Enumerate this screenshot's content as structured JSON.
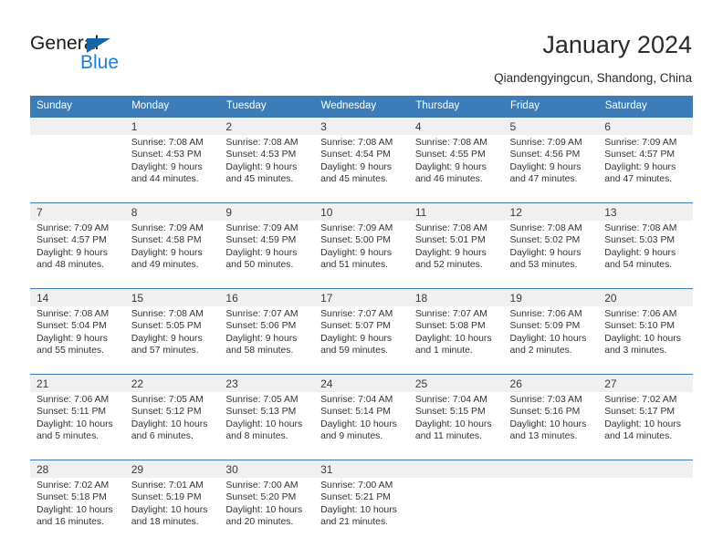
{
  "logo": {
    "word_top": "General",
    "word_bottom": "Blue",
    "triangle_color": "#1464aa",
    "blue_color": "#1f7fd4"
  },
  "header": {
    "title": "January 2024",
    "location": "Qiandengyingcun, Shandong, China",
    "header_bg": "#3b7cb9",
    "daynum_bg": "#f0f0f0"
  },
  "weekdays": [
    "Sunday",
    "Monday",
    "Tuesday",
    "Wednesday",
    "Thursday",
    "Friday",
    "Saturday"
  ],
  "weeks": [
    [
      {
        "day": "",
        "sunrise": "",
        "sunset": "",
        "daylight1": "",
        "daylight2": ""
      },
      {
        "day": "1",
        "sunrise": "Sunrise: 7:08 AM",
        "sunset": "Sunset: 4:53 PM",
        "daylight1": "Daylight: 9 hours",
        "daylight2": "and 44 minutes."
      },
      {
        "day": "2",
        "sunrise": "Sunrise: 7:08 AM",
        "sunset": "Sunset: 4:53 PM",
        "daylight1": "Daylight: 9 hours",
        "daylight2": "and 45 minutes."
      },
      {
        "day": "3",
        "sunrise": "Sunrise: 7:08 AM",
        "sunset": "Sunset: 4:54 PM",
        "daylight1": "Daylight: 9 hours",
        "daylight2": "and 45 minutes."
      },
      {
        "day": "4",
        "sunrise": "Sunrise: 7:08 AM",
        "sunset": "Sunset: 4:55 PM",
        "daylight1": "Daylight: 9 hours",
        "daylight2": "and 46 minutes."
      },
      {
        "day": "5",
        "sunrise": "Sunrise: 7:09 AM",
        "sunset": "Sunset: 4:56 PM",
        "daylight1": "Daylight: 9 hours",
        "daylight2": "and 47 minutes."
      },
      {
        "day": "6",
        "sunrise": "Sunrise: 7:09 AM",
        "sunset": "Sunset: 4:57 PM",
        "daylight1": "Daylight: 9 hours",
        "daylight2": "and 47 minutes."
      }
    ],
    [
      {
        "day": "7",
        "sunrise": "Sunrise: 7:09 AM",
        "sunset": "Sunset: 4:57 PM",
        "daylight1": "Daylight: 9 hours",
        "daylight2": "and 48 minutes."
      },
      {
        "day": "8",
        "sunrise": "Sunrise: 7:09 AM",
        "sunset": "Sunset: 4:58 PM",
        "daylight1": "Daylight: 9 hours",
        "daylight2": "and 49 minutes."
      },
      {
        "day": "9",
        "sunrise": "Sunrise: 7:09 AM",
        "sunset": "Sunset: 4:59 PM",
        "daylight1": "Daylight: 9 hours",
        "daylight2": "and 50 minutes."
      },
      {
        "day": "10",
        "sunrise": "Sunrise: 7:09 AM",
        "sunset": "Sunset: 5:00 PM",
        "daylight1": "Daylight: 9 hours",
        "daylight2": "and 51 minutes."
      },
      {
        "day": "11",
        "sunrise": "Sunrise: 7:08 AM",
        "sunset": "Sunset: 5:01 PM",
        "daylight1": "Daylight: 9 hours",
        "daylight2": "and 52 minutes."
      },
      {
        "day": "12",
        "sunrise": "Sunrise: 7:08 AM",
        "sunset": "Sunset: 5:02 PM",
        "daylight1": "Daylight: 9 hours",
        "daylight2": "and 53 minutes."
      },
      {
        "day": "13",
        "sunrise": "Sunrise: 7:08 AM",
        "sunset": "Sunset: 5:03 PM",
        "daylight1": "Daylight: 9 hours",
        "daylight2": "and 54 minutes."
      }
    ],
    [
      {
        "day": "14",
        "sunrise": "Sunrise: 7:08 AM",
        "sunset": "Sunset: 5:04 PM",
        "daylight1": "Daylight: 9 hours",
        "daylight2": "and 55 minutes."
      },
      {
        "day": "15",
        "sunrise": "Sunrise: 7:08 AM",
        "sunset": "Sunset: 5:05 PM",
        "daylight1": "Daylight: 9 hours",
        "daylight2": "and 57 minutes."
      },
      {
        "day": "16",
        "sunrise": "Sunrise: 7:07 AM",
        "sunset": "Sunset: 5:06 PM",
        "daylight1": "Daylight: 9 hours",
        "daylight2": "and 58 minutes."
      },
      {
        "day": "17",
        "sunrise": "Sunrise: 7:07 AM",
        "sunset": "Sunset: 5:07 PM",
        "daylight1": "Daylight: 9 hours",
        "daylight2": "and 59 minutes."
      },
      {
        "day": "18",
        "sunrise": "Sunrise: 7:07 AM",
        "sunset": "Sunset: 5:08 PM",
        "daylight1": "Daylight: 10 hours",
        "daylight2": "and 1 minute."
      },
      {
        "day": "19",
        "sunrise": "Sunrise: 7:06 AM",
        "sunset": "Sunset: 5:09 PM",
        "daylight1": "Daylight: 10 hours",
        "daylight2": "and 2 minutes."
      },
      {
        "day": "20",
        "sunrise": "Sunrise: 7:06 AM",
        "sunset": "Sunset: 5:10 PM",
        "daylight1": "Daylight: 10 hours",
        "daylight2": "and 3 minutes."
      }
    ],
    [
      {
        "day": "21",
        "sunrise": "Sunrise: 7:06 AM",
        "sunset": "Sunset: 5:11 PM",
        "daylight1": "Daylight: 10 hours",
        "daylight2": "and 5 minutes."
      },
      {
        "day": "22",
        "sunrise": "Sunrise: 7:05 AM",
        "sunset": "Sunset: 5:12 PM",
        "daylight1": "Daylight: 10 hours",
        "daylight2": "and 6 minutes."
      },
      {
        "day": "23",
        "sunrise": "Sunrise: 7:05 AM",
        "sunset": "Sunset: 5:13 PM",
        "daylight1": "Daylight: 10 hours",
        "daylight2": "and 8 minutes."
      },
      {
        "day": "24",
        "sunrise": "Sunrise: 7:04 AM",
        "sunset": "Sunset: 5:14 PM",
        "daylight1": "Daylight: 10 hours",
        "daylight2": "and 9 minutes."
      },
      {
        "day": "25",
        "sunrise": "Sunrise: 7:04 AM",
        "sunset": "Sunset: 5:15 PM",
        "daylight1": "Daylight: 10 hours",
        "daylight2": "and 11 minutes."
      },
      {
        "day": "26",
        "sunrise": "Sunrise: 7:03 AM",
        "sunset": "Sunset: 5:16 PM",
        "daylight1": "Daylight: 10 hours",
        "daylight2": "and 13 minutes."
      },
      {
        "day": "27",
        "sunrise": "Sunrise: 7:02 AM",
        "sunset": "Sunset: 5:17 PM",
        "daylight1": "Daylight: 10 hours",
        "daylight2": "and 14 minutes."
      }
    ],
    [
      {
        "day": "28",
        "sunrise": "Sunrise: 7:02 AM",
        "sunset": "Sunset: 5:18 PM",
        "daylight1": "Daylight: 10 hours",
        "daylight2": "and 16 minutes."
      },
      {
        "day": "29",
        "sunrise": "Sunrise: 7:01 AM",
        "sunset": "Sunset: 5:19 PM",
        "daylight1": "Daylight: 10 hours",
        "daylight2": "and 18 minutes."
      },
      {
        "day": "30",
        "sunrise": "Sunrise: 7:00 AM",
        "sunset": "Sunset: 5:20 PM",
        "daylight1": "Daylight: 10 hours",
        "daylight2": "and 20 minutes."
      },
      {
        "day": "31",
        "sunrise": "Sunrise: 7:00 AM",
        "sunset": "Sunset: 5:21 PM",
        "daylight1": "Daylight: 10 hours",
        "daylight2": "and 21 minutes."
      },
      {
        "day": "",
        "sunrise": "",
        "sunset": "",
        "daylight1": "",
        "daylight2": ""
      },
      {
        "day": "",
        "sunrise": "",
        "sunset": "",
        "daylight1": "",
        "daylight2": ""
      },
      {
        "day": "",
        "sunrise": "",
        "sunset": "",
        "daylight1": "",
        "daylight2": ""
      }
    ]
  ]
}
